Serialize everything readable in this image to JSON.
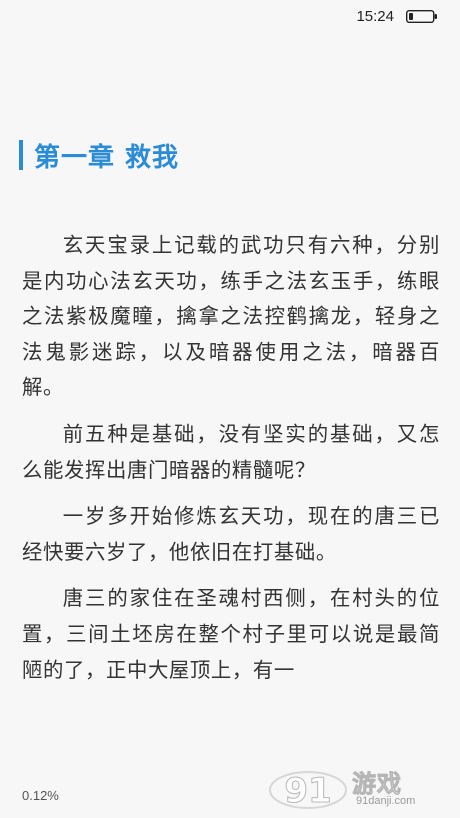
{
  "status_bar": {
    "time": "15:24",
    "battery_icon": "battery-icon"
  },
  "chapter": {
    "title": "第一章 救我",
    "accent_color": "#2a8bd6"
  },
  "content": {
    "paragraphs": [
      "玄天宝录上记载的武功只有六种，分别是内功心法玄天功，练手之法玄玉手，练眼之法紫极魔瞳，擒拿之法控鹤擒龙，轻身之法鬼影迷踪，以及暗器使用之法，暗器百解。",
      "前五种是基础，没有坚实的基础，又怎么能发挥出唐门暗器的精髓呢？",
      "一岁多开始修炼玄天功，现在的唐三已经快要六岁了，他依旧在打基础。",
      "唐三的家住在圣魂村西侧，在村头的位置，三间土坯房在整个村子里可以说是最简陋的了，正中大屋顶上，有一"
    ]
  },
  "footer": {
    "progress": "0.12%"
  },
  "watermark": {
    "logo_mark": "91",
    "brand": "游戏",
    "domain": "91danji.com"
  }
}
